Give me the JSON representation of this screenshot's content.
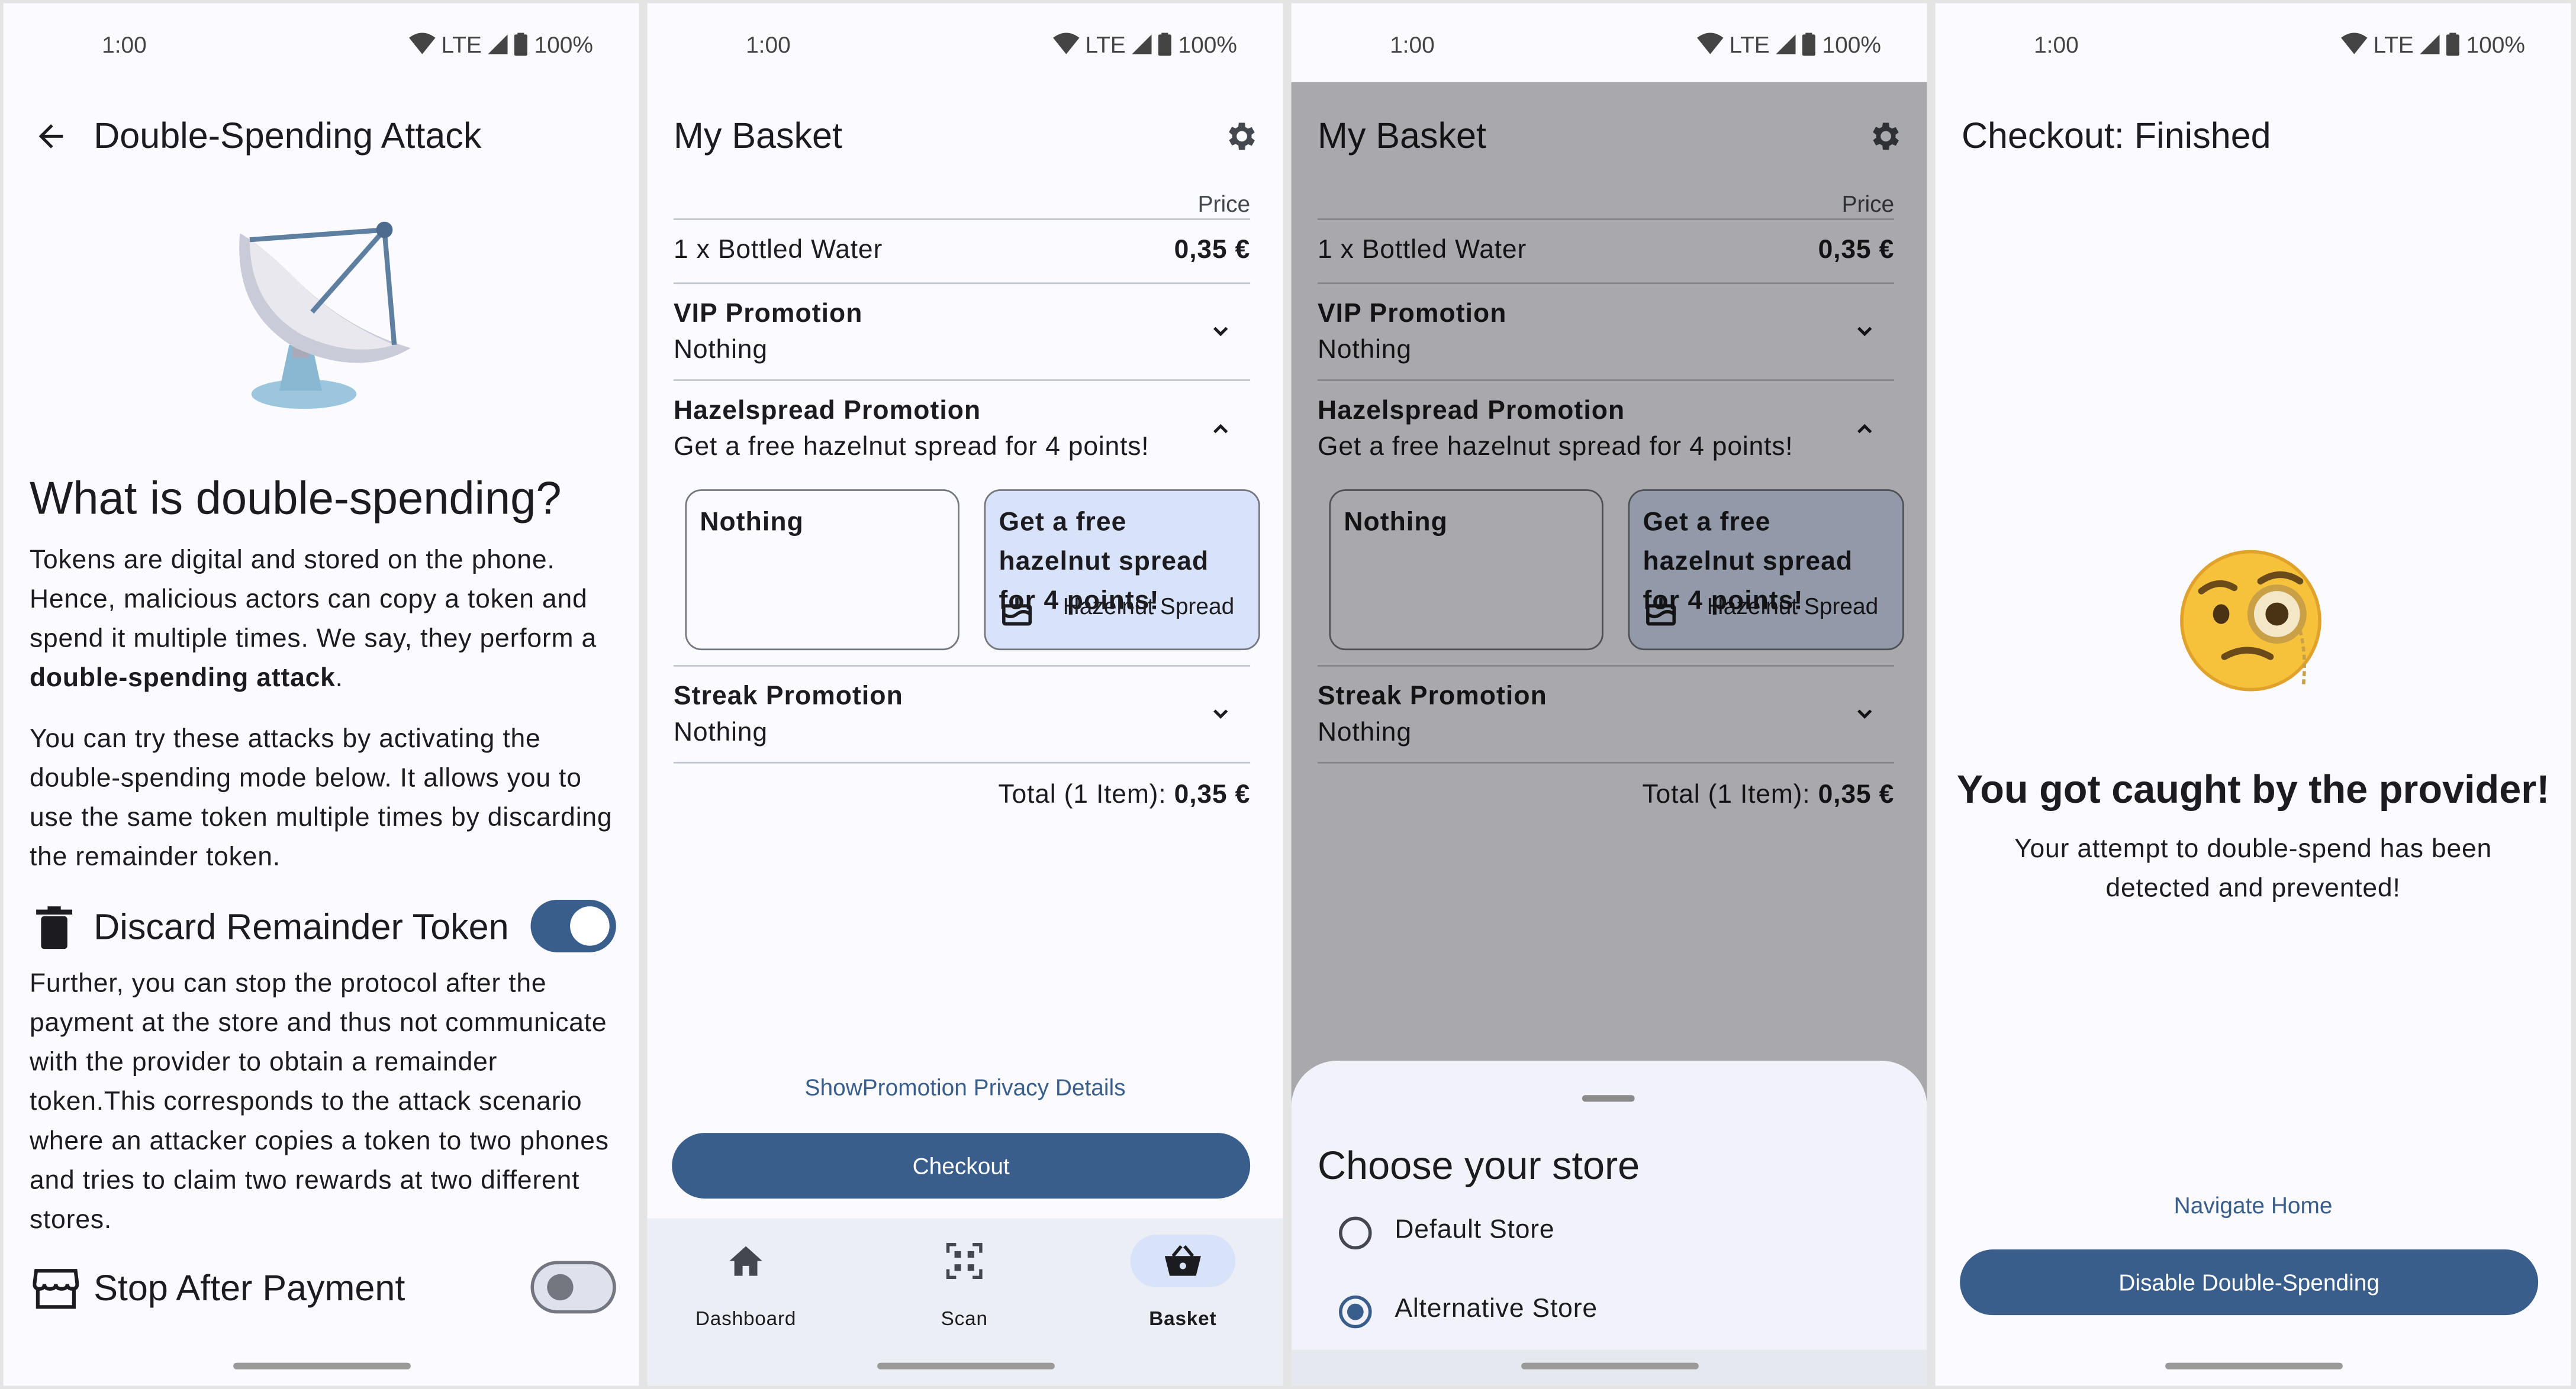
{
  "status_bar": {
    "time": "1:00",
    "network": "LTE",
    "battery": "100%"
  },
  "screen1": {
    "title": "Double-Spending Attack",
    "heading": "What is double-spending?",
    "para1_plain": "Tokens are digital and stored on the phone. Hence, malicious actors can copy a token and spend it multiple times. We say, they perform a ",
    "para1_bold": "double-spending attack",
    "para1_end": ".",
    "para2": "You can try these attacks by activating the double-spending mode below. It allows you to use the same token multiple times by discarding the remainder token.",
    "discard_label": "Discard Remainder Token",
    "discard_on": true,
    "para3": "Further, you can stop the protocol after the payment at the store and thus not communicate with the provider to obtain a remainder token.This corresponds to the attack scenario where an attacker copies a token to two phones and tries to claim two rewards at two different stores.",
    "stop_label": "Stop After Payment",
    "stop_on": false
  },
  "basket": {
    "title": "My Basket",
    "price_header": "Price",
    "item": "1 x Bottled Water",
    "item_price": "0,35 €",
    "vip_title": "VIP Promotion",
    "vip_value": "Nothing",
    "hazel_title": "Hazelspread Promotion",
    "hazel_value": "Get a free hazelnut spread for 4 points!",
    "option_nothing": "Nothing",
    "option_reward_title": "Get a free hazelnut spread for 4 points!",
    "option_reward_product": "Hazelnut Spread",
    "streak_title": "Streak Promotion",
    "streak_value": "Nothing",
    "total_label": "Total (1 Item):",
    "total_value": "0,35 €",
    "privacy_link": "ShowPromotion Privacy Details",
    "checkout": "Checkout",
    "nav": [
      "Dashboard",
      "Scan",
      "Basket"
    ]
  },
  "store_sheet": {
    "title": "Choose your store",
    "options": [
      "Default Store",
      "Alternative Store"
    ],
    "selected": "Alternative Store"
  },
  "finished": {
    "title": "Checkout: Finished",
    "emoji": "🧐",
    "headline": "You got caught by the provider!",
    "message": "Your attempt to double-spend has been detected and prevented!",
    "navigate_home": "Navigate Home",
    "disable_button": "Disable Double-Spending"
  },
  "colors": {
    "primary": "#3a5e8c",
    "selected_card": "#d8e2f8",
    "background": "#fafaff"
  }
}
